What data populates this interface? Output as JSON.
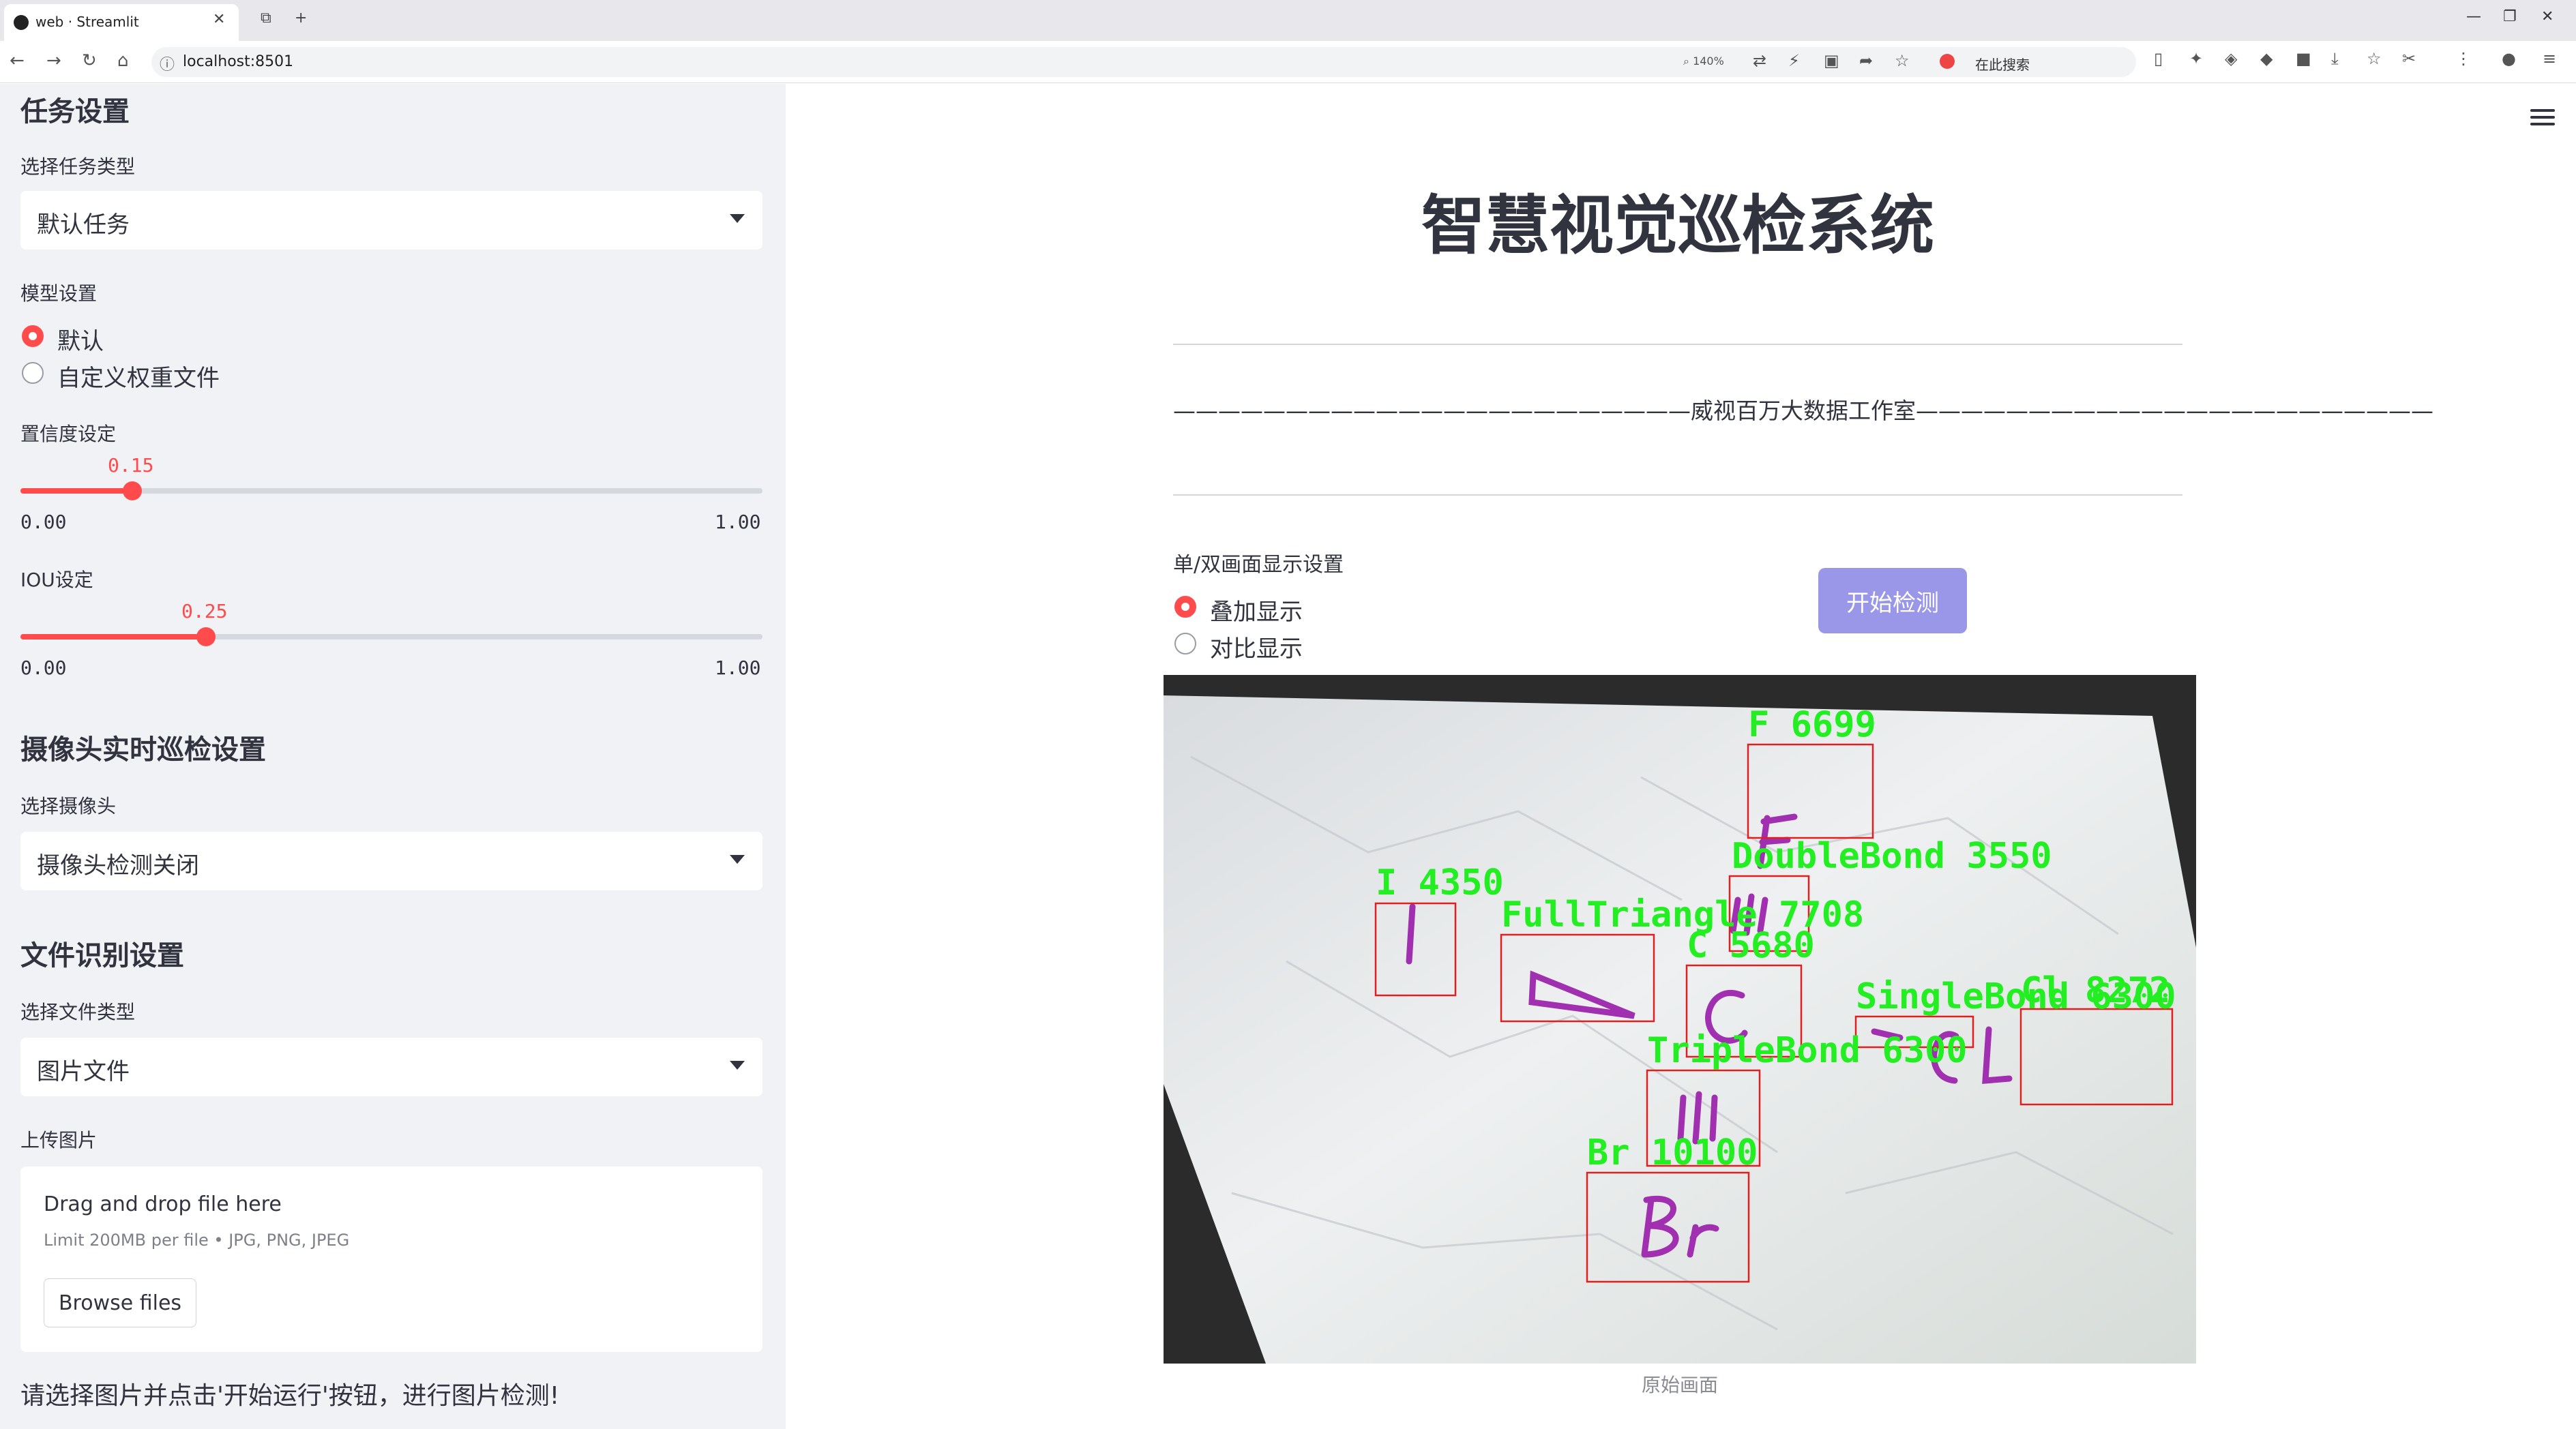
{
  "browser": {
    "tab_title": "web · Streamlit",
    "url": "localhost:8501",
    "zoom": "140%",
    "search_placeholder": "在此搜索"
  },
  "sidebar": {
    "task_heading": "任务设置",
    "task_type_label": "选择任务类型",
    "task_type_value": "默认任务",
    "model_label": "模型设置",
    "model_options": [
      "默认",
      "自定义权重文件"
    ],
    "model_selected": 0,
    "conf_label": "置信度设定",
    "conf_value": "0.15",
    "conf_min": "0.00",
    "conf_max": "1.00",
    "iou_label": "IOU设定",
    "iou_value": "0.25",
    "iou_min": "0.00",
    "iou_max": "1.00",
    "camera_heading": "摄像头实时巡检设置",
    "camera_label": "选择摄像头",
    "camera_value": "摄像头检测关闭",
    "file_heading": "文件识别设置",
    "file_type_label": "选择文件类型",
    "file_type_value": "图片文件",
    "upload_label": "上传图片",
    "upload_title": "Drag and drop file here",
    "upload_limit": "Limit 200MB per file • JPG, PNG, JPEG",
    "browse_label": "Browse files",
    "note": "请选择图片并点击'开始运行'按钮，进行图片检测!"
  },
  "main": {
    "title": "智慧视觉巡检系统",
    "subtitle": "———————————————————————威视百万大数据工作室———————————————————————",
    "display_label": "单/双画面显示设置",
    "display_options": [
      "叠加显示",
      "对比显示"
    ],
    "display_selected": 0,
    "start_button": "开始检测",
    "caption": "原始画面"
  },
  "detections": [
    {
      "label": "F 6699"
    },
    {
      "label": "DoubleBond 3550"
    },
    {
      "label": "I 4350"
    },
    {
      "label": "FullTriangle 7708"
    },
    {
      "label": "C 5680"
    },
    {
      "label": "SingleBond 6300"
    },
    {
      "label": "Cl 8272"
    },
    {
      "label": "TripleBond 6300"
    },
    {
      "label": "Br 10100"
    }
  ],
  "colors": {
    "accent": "#ff4b4b",
    "button": "#9a97e8",
    "box": "#e02020",
    "box_label": "#22ee22",
    "ink": "#a030b0"
  }
}
